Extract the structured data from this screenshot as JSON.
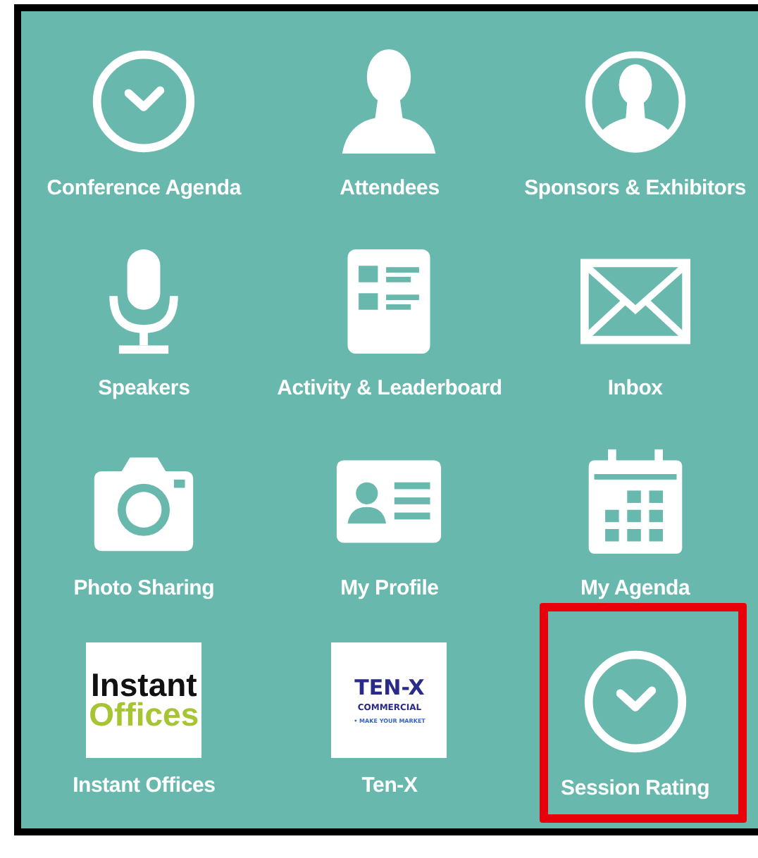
{
  "items": [
    {
      "kind": "icon",
      "label": "Conference Agenda",
      "highlighted": false
    },
    {
      "kind": "icon",
      "label": "Attendees",
      "highlighted": false
    },
    {
      "kind": "icon",
      "label": "Sponsors & Exhibitors",
      "highlighted": false
    },
    {
      "kind": "icon",
      "label": "Speakers",
      "highlighted": false
    },
    {
      "kind": "icon",
      "label": "Activity & Leaderboard",
      "highlighted": false
    },
    {
      "kind": "icon",
      "label": "Inbox",
      "highlighted": false
    },
    {
      "kind": "icon",
      "label": "Photo Sharing",
      "highlighted": false
    },
    {
      "kind": "icon",
      "label": "My Profile",
      "highlighted": false
    },
    {
      "kind": "icon",
      "label": "My Agenda",
      "highlighted": false
    },
    {
      "kind": "logo",
      "label": "Instant Offices",
      "logo_lines": [
        "Instant",
        "Offices"
      ],
      "highlighted": false
    },
    {
      "kind": "logo",
      "label": "Ten-X",
      "logo_lines": [
        "TEN-X",
        "COMMERCIAL",
        "• MAKE YOUR MARKET"
      ],
      "highlighted": false
    },
    {
      "kind": "icon",
      "label": "Session Rating",
      "highlighted": true
    }
  ]
}
